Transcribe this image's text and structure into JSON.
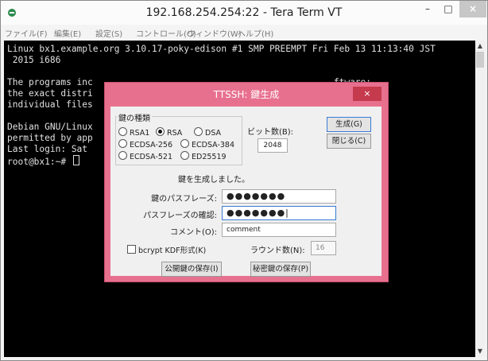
{
  "window": {
    "title": "192.168.254.254:22 - Tera Term VT",
    "controls": {
      "minimize": "–",
      "maximize": "□",
      "close": "×"
    }
  },
  "menu": [
    "ファイル(F)",
    "編集(E)",
    "設定(S)",
    "コントロール(O)",
    "ウィンドウ(W)",
    "ヘルプ(H)"
  ],
  "terminal": {
    "lines": [
      "Linux bx1.example.org 3.10.17-poky-edison #1 SMP PREEMPT Fri Feb 13 11:13:40 JST",
      " 2015 i686",
      "",
      "The programs inc                                             ftware;",
      "the exact distri",
      "individual files",
      "",
      "Debian GNU/Linux",
      "permitted by app",
      "Last login: Sat ",
      "root@bx1:~# "
    ]
  },
  "scrollbar": {
    "up": "▲",
    "down": "▼"
  },
  "dialog": {
    "title": "TTSSH: 鍵生成",
    "close": "×",
    "key_type_label": "鍵の種類",
    "options": [
      {
        "label": "RSA1",
        "selected": false
      },
      {
        "label": "RSA",
        "selected": true
      },
      {
        "label": "DSA",
        "selected": false
      },
      {
        "label": "ECDSA-256",
        "selected": false
      },
      {
        "label": "ECDSA-384",
        "selected": false
      },
      {
        "label": "ECDSA-521",
        "selected": false
      },
      {
        "label": "ED25519",
        "selected": false
      }
    ],
    "bits_label": "ビット数(B):",
    "bits_value": "2048",
    "generate_button": "生成(G)",
    "close_button": "閉じる(C)",
    "status_message": "鍵を生成しました。",
    "passphrase_label": "鍵のパスフレーズ:",
    "passphrase_value": "●●●●●●●",
    "confirm_label": "パスフレーズの確認:",
    "confirm_value": "●●●●●●●|",
    "comment_label": "コメント(O):",
    "comment_value": "comment",
    "bcrypt_label": "bcrypt KDF形式(K)",
    "rounds_label": "ラウンド数(N):",
    "rounds_value": "16",
    "save_public_button": "公開鍵の保存(I)",
    "save_private_button": "秘密鍵の保存(P)"
  },
  "colors": {
    "dialog_frame": "#e8708f",
    "dialog_close": "#c63a4d",
    "terminal_bg": "#000000",
    "terminal_fg": "#e0e0e0"
  }
}
